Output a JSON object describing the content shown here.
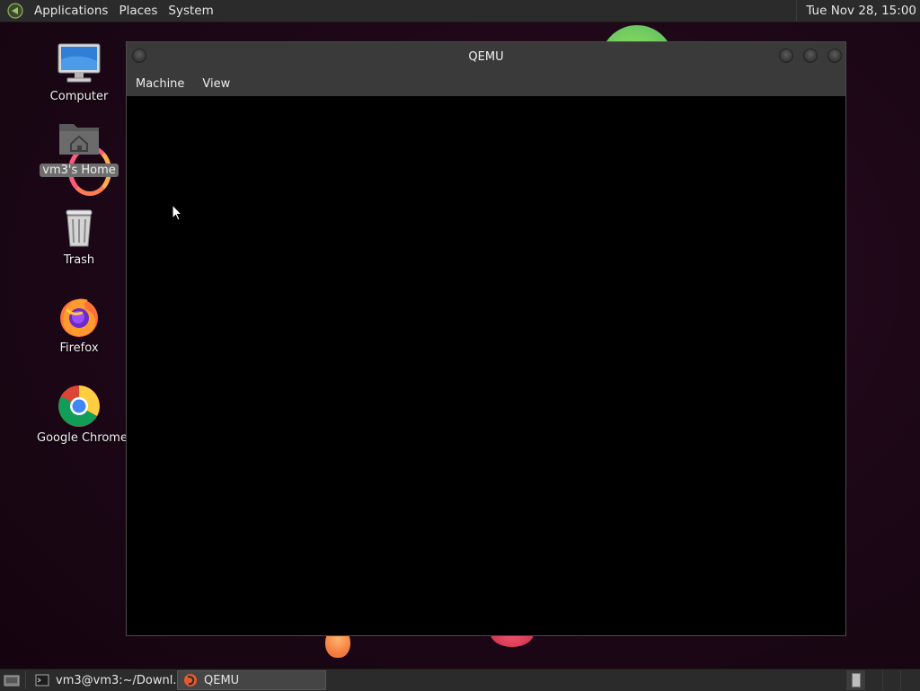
{
  "top_panel": {
    "menus": [
      "Applications",
      "Places",
      "System"
    ],
    "clock": "Tue Nov 28, 15:00"
  },
  "desktop": {
    "icons": [
      {
        "label": "Computer",
        "icon": "computer-icon"
      },
      {
        "label": "vm3's Home",
        "icon": "home-folder-icon",
        "selected": true
      },
      {
        "label": "Trash",
        "icon": "trash-icon"
      },
      {
        "label": "Firefox",
        "icon": "firefox-icon"
      },
      {
        "label": "Google Chrome",
        "icon": "chrome-icon"
      }
    ]
  },
  "window": {
    "title": "QEMU",
    "menus": [
      "Machine",
      "View"
    ]
  },
  "taskbar": {
    "tasks": [
      {
        "label": "vm3@vm3:~/Downl...",
        "icon": "terminal-icon"
      },
      {
        "label": "QEMU",
        "icon": "qemu-icon",
        "active": true
      }
    ]
  },
  "colors": {
    "panel": "#2b2b2b",
    "desktop": "#1c0716",
    "window_chrome": "#3a3a3a"
  }
}
